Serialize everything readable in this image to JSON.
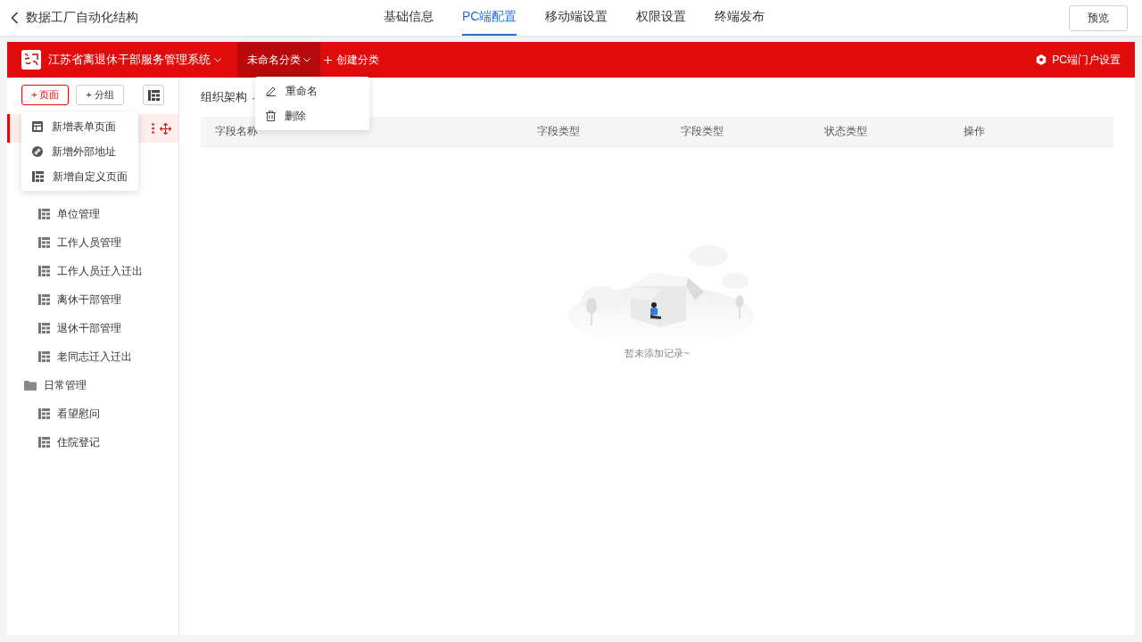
{
  "header": {
    "back_label": "数据工厂自动化结构",
    "tabs": [
      {
        "label": "基础信息",
        "selected": false
      },
      {
        "label": "PC端配置",
        "selected": true
      },
      {
        "label": "移动端设置",
        "selected": false
      },
      {
        "label": "权限设置",
        "selected": false
      },
      {
        "label": "终端发布",
        "selected": false
      }
    ],
    "preview_button": "预览"
  },
  "app_bar": {
    "system_name": "江苏省离退休干部服务管理系统",
    "categories": [
      {
        "label": "未命名分类",
        "selected": true
      }
    ],
    "create_category": "创建分类",
    "portal_settings": "PC端门户设置"
  },
  "category_menu": [
    "重命名",
    "删除"
  ],
  "sidebar": {
    "add_page": "+ 页面",
    "add_group": "+ 分组",
    "add_page_menu": [
      {
        "kind": "form",
        "label": "新增表单页面"
      },
      {
        "kind": "link",
        "label": "新增外部地址"
      },
      {
        "kind": "custom",
        "label": "新增自定义页面"
      }
    ],
    "tree": [
      {
        "selected": true
      },
      {
        "selected": false,
        "children": [
          {
            "label": "单位管理",
            "selected": false
          },
          {
            "label": "工作人员管理",
            "selected": false
          },
          {
            "label": "工作人员迁入迁出",
            "selected": false
          },
          {
            "label": "离休干部管理",
            "selected": false
          },
          {
            "label": "退休干部管理",
            "selected": false
          },
          {
            "label": "老同志迁入迁出",
            "selected": false
          }
        ]
      },
      {
        "label": "日常管理",
        "selected": false,
        "children": [
          {
            "label": "看望慰问",
            "selected": false
          },
          {
            "label": "住院登记",
            "selected": false
          }
        ]
      }
    ]
  },
  "main": {
    "breadcrumb": "组织架构",
    "breadcrumb_separator": "·",
    "table": {
      "columns": [
        "字段名称",
        "字段类型",
        "字段类型",
        "状态类型",
        "操作"
      ]
    },
    "empty_text": "暂未添加记录~"
  }
}
